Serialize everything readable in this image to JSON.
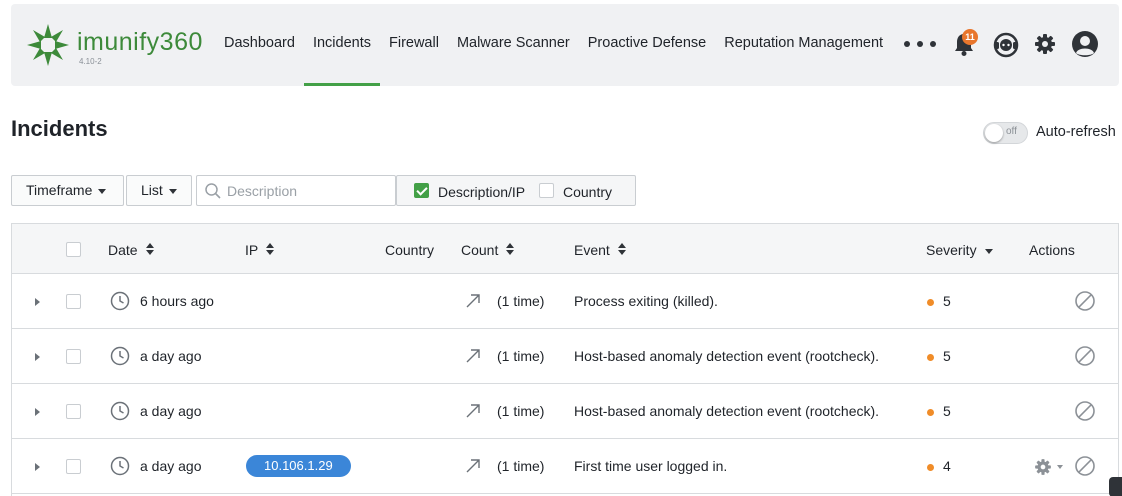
{
  "app": {
    "brand": "imunify360",
    "version": "4.10-2"
  },
  "nav": {
    "items": [
      {
        "label": "Dashboard",
        "active": false
      },
      {
        "label": "Incidents",
        "active": true
      },
      {
        "label": "Firewall",
        "active": false
      },
      {
        "label": "Malware Scanner",
        "active": false
      },
      {
        "label": "Proactive Defense",
        "active": false
      },
      {
        "label": "Reputation Management",
        "active": false
      }
    ],
    "notifications_count": "11"
  },
  "page": {
    "title": "Incidents",
    "auto_refresh": {
      "label": "Auto-refresh",
      "state_text": "off",
      "enabled": false
    }
  },
  "filters": {
    "timeframe_label": "Timeframe",
    "view_label": "List",
    "search_placeholder": "Description",
    "search_value": "",
    "description_ip_label": "Description/IP",
    "description_ip_checked": true,
    "country_label": "Country",
    "country_checked": false
  },
  "table": {
    "columns": {
      "date": "Date",
      "ip": "IP",
      "country": "Country",
      "count": "Count",
      "event": "Event",
      "severity": "Severity",
      "actions": "Actions"
    },
    "rows": [
      {
        "date": "6 hours ago",
        "ip": "",
        "country": "",
        "count": "(1 time)",
        "event": "Process exiting (killed).",
        "severity": "5"
      },
      {
        "date": "a day ago",
        "ip": "",
        "country": "",
        "count": "(1 time)",
        "event": "Host-based anomaly detection event (rootcheck).",
        "severity": "5"
      },
      {
        "date": "a day ago",
        "ip": "",
        "country": "",
        "count": "(1 time)",
        "event": "Host-based anomaly detection event (rootcheck).",
        "severity": "5"
      },
      {
        "date": "a day ago",
        "ip": "10.106.1.29",
        "country": "",
        "count": "(1 time)",
        "event": "First time user logged in.",
        "severity": "4"
      }
    ]
  },
  "colors": {
    "accent_green": "#43a047",
    "ip_pill_blue": "#3b86d8",
    "severity_orange": "#f08c28",
    "badge_orange": "#e8762c"
  }
}
